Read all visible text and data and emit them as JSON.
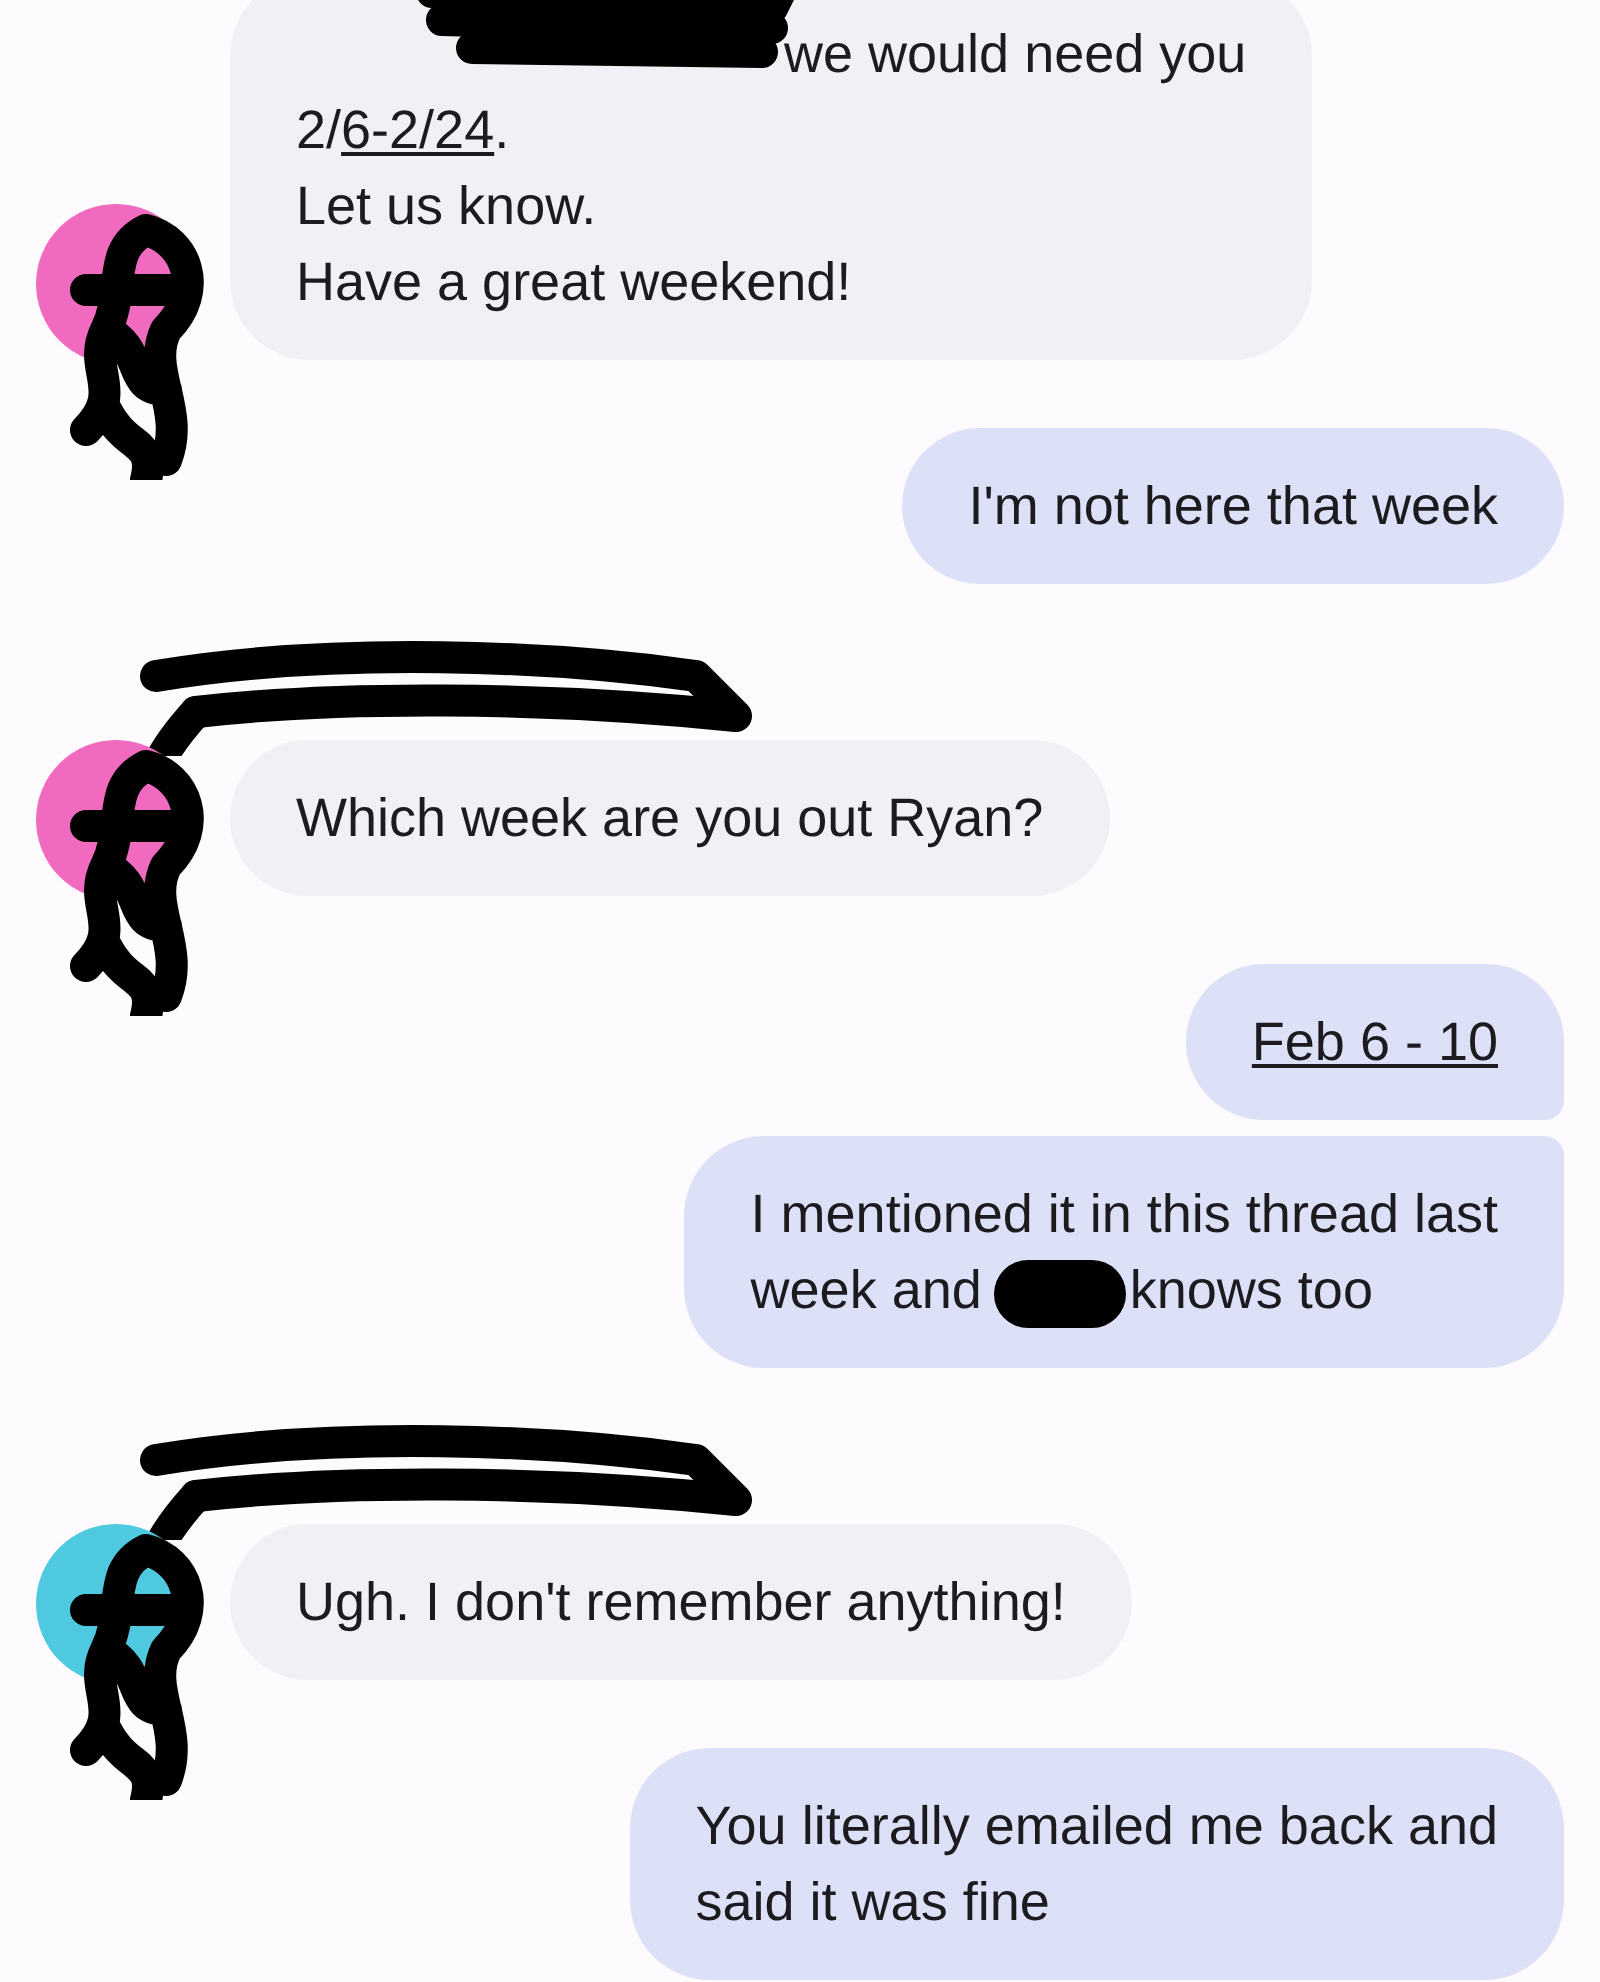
{
  "messages": [
    {
      "kind": "received",
      "color": "#f06bc0",
      "lines": [
        [
          {
            "kind": "redacted"
          },
          {
            "kind": "text",
            "text": "we would need you"
          }
        ],
        [
          {
            "kind": "text",
            "text": "2/"
          },
          {
            "kind": "link",
            "text": "6-2/24"
          },
          {
            "kind": "text",
            "text": "."
          }
        ],
        [
          {
            "kind": "text",
            "text": "Let us know."
          }
        ],
        [
          {
            "kind": "text",
            "text": "Have a great weekend!"
          }
        ]
      ]
    },
    {
      "kind": "sent",
      "lines": [
        [
          {
            "kind": "text",
            "text": "I'm not here that week"
          }
        ]
      ]
    },
    {
      "kind": "received",
      "color": "#f06bc0",
      "lines": [
        [
          {
            "kind": "text",
            "text": "Which week are you out Ryan?"
          }
        ]
      ]
    },
    {
      "kind": "sent",
      "lines": [
        [
          {
            "kind": "link",
            "text": "Feb 6 - 10"
          }
        ]
      ]
    },
    {
      "kind": "sent",
      "lines": [
        [
          {
            "kind": "text",
            "text": "I mentioned it in this thread last"
          }
        ],
        [
          {
            "kind": "text",
            "text": "week and"
          },
          {
            "kind": "redacted"
          },
          {
            "kind": "text",
            "text": "knows too"
          }
        ]
      ]
    },
    {
      "kind": "received",
      "color": "#4fc9e0",
      "lines": [
        [
          {
            "kind": "text",
            "text": "Ugh. I don't remember anything!"
          }
        ]
      ]
    },
    {
      "kind": "sent",
      "lines": [
        [
          {
            "kind": "text",
            "text": "You literally emailed me back and"
          }
        ],
        [
          {
            "kind": "text",
            "text": "said it was fine"
          }
        ]
      ]
    }
  ]
}
